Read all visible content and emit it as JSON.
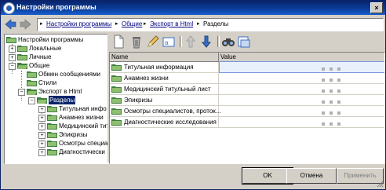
{
  "window": {
    "title": "Настройки программы",
    "close_glyph": "×"
  },
  "breadcrumb": {
    "items": [
      "Настройки программы",
      "Общие",
      "Экспорт в Html",
      "Разделы"
    ],
    "separator": "▸"
  },
  "tree": {
    "items": [
      {
        "label": "Настройки программы",
        "level": 0
      },
      {
        "label": "Локальные",
        "level": 1,
        "expander": "+"
      },
      {
        "label": "Личные",
        "level": 1,
        "expander": "+"
      },
      {
        "label": "Общие",
        "level": 1,
        "expander": "−"
      },
      {
        "label": "Обмен сообщениями",
        "level": 2
      },
      {
        "label": "Стили",
        "level": 2
      },
      {
        "label": "Экспорт в Html",
        "level": 2,
        "expander": "−"
      },
      {
        "label": "Разделы",
        "level": 3,
        "expander": "−",
        "selected": true
      },
      {
        "label": "Титульная инфо",
        "level": 4,
        "expander": "+"
      },
      {
        "label": "Анамнез жизни",
        "level": 4,
        "expander": "+"
      },
      {
        "label": "Медицинский тит",
        "level": 4,
        "expander": "+"
      },
      {
        "label": "Эпикризы",
        "level": 4,
        "expander": "+"
      },
      {
        "label": "Осмотры специа",
        "level": 4,
        "expander": "+"
      },
      {
        "label": "Диагностически",
        "level": 4,
        "expander": "+"
      }
    ]
  },
  "toolbar": {
    "buttons": [
      "new-document-icon",
      "delete-icon",
      "edit-pencil-icon",
      "rename-icon",
      "move-up-icon",
      "move-down-icon",
      "find-icon",
      "properties-icon"
    ]
  },
  "grid": {
    "columns": [
      "Name",
      "Value"
    ],
    "rows": [
      {
        "name": "Титульная информация",
        "selected": true
      },
      {
        "name": "Анамнез жизни"
      },
      {
        "name": "Медицинский титульный лист"
      },
      {
        "name": "Эпикризы"
      },
      {
        "name": "Осмотры специалистов, проток..."
      },
      {
        "name": "Диагностические исследования"
      }
    ]
  },
  "buttons": {
    "ok": "OK",
    "cancel": "Отмена",
    "apply": "Применить"
  },
  "colors": {
    "title_bar": "#0a246a",
    "selection": "#0a246a",
    "folder": "#3f7f3f"
  }
}
